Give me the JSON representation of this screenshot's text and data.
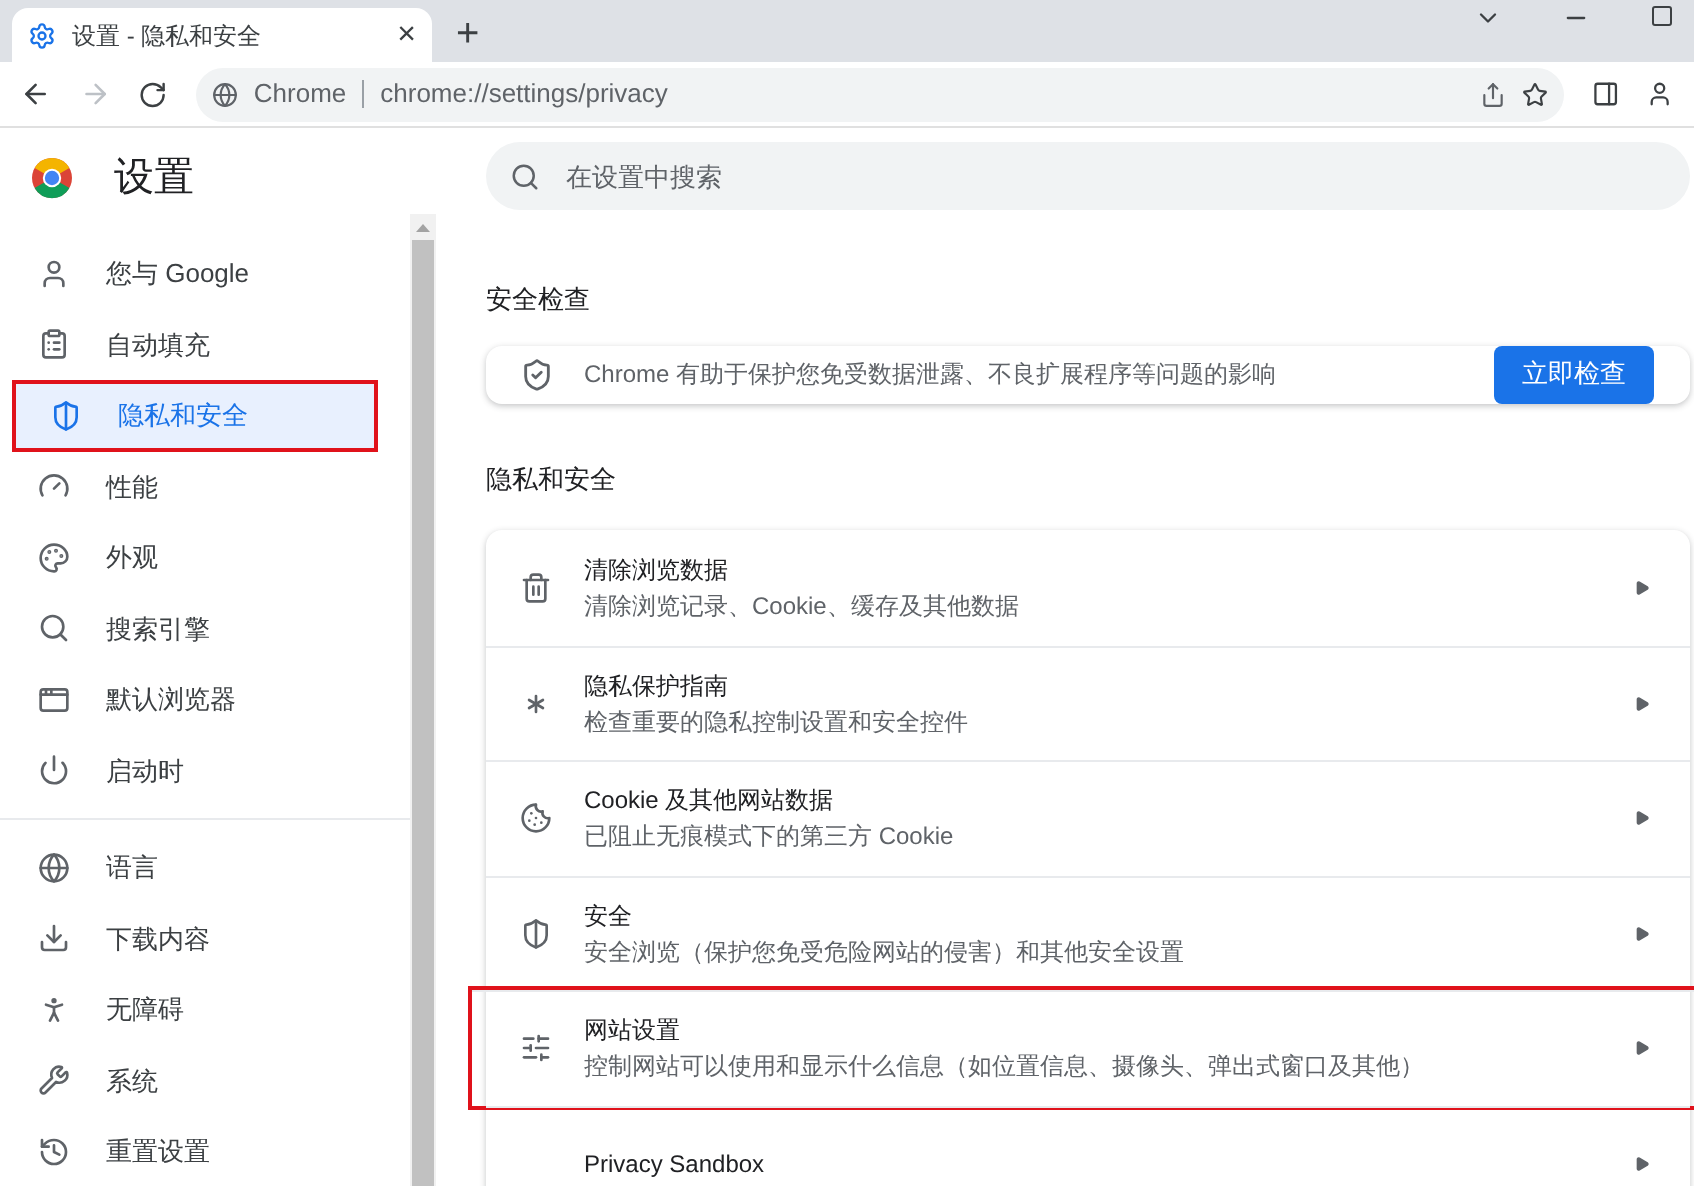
{
  "browser": {
    "tab": {
      "title": "设置 - 隐私和安全",
      "close": "×"
    },
    "new_tab": "+",
    "address": {
      "site": "Chrome",
      "url": "chrome://settings/privacy"
    }
  },
  "header": {
    "title": "设置"
  },
  "sidebar": {
    "groups": [
      [
        {
          "label": "您与 Google",
          "selected": false,
          "highlighted": false
        },
        {
          "label": "自动填充",
          "selected": false,
          "highlighted": false
        },
        {
          "label": "隐私和安全",
          "selected": true,
          "highlighted": true
        },
        {
          "label": "性能",
          "selected": false,
          "highlighted": false
        },
        {
          "label": "外观",
          "selected": false,
          "highlighted": false
        },
        {
          "label": "搜索引擎",
          "selected": false,
          "highlighted": false
        },
        {
          "label": "默认浏览器",
          "selected": false,
          "highlighted": false
        },
        {
          "label": "启动时",
          "selected": false,
          "highlighted": false
        }
      ],
      [
        {
          "label": "语言",
          "selected": false,
          "highlighted": false
        },
        {
          "label": "下载内容",
          "selected": false,
          "highlighted": false
        },
        {
          "label": "无障碍",
          "selected": false,
          "highlighted": false
        },
        {
          "label": "系统",
          "selected": false,
          "highlighted": false
        },
        {
          "label": "重置设置",
          "selected": false,
          "highlighted": false
        }
      ]
    ]
  },
  "search": {
    "placeholder": "在设置中搜索"
  },
  "safety_check": {
    "heading": "安全检查",
    "text": "Chrome 有助于保护您免受数据泄露、不良扩展程序等问题的影响",
    "button": "立即检查"
  },
  "privacy": {
    "heading": "隐私和安全",
    "rows": [
      {
        "title": "清除浏览数据",
        "subtitle": "清除浏览记录、Cookie、缓存及其他数据",
        "highlighted": false
      },
      {
        "title": "隐私保护指南",
        "subtitle": "检查重要的隐私控制设置和安全控件",
        "highlighted": false
      },
      {
        "title": "Cookie 及其他网站数据",
        "subtitle": "已阻止无痕模式下的第三方 Cookie",
        "highlighted": false
      },
      {
        "title": "安全",
        "subtitle": "安全浏览（保护您免受危险网站的侵害）和其他安全设置",
        "highlighted": false
      },
      {
        "title": "网站设置",
        "subtitle": "控制网站可以使用和显示什么信息（如位置信息、摄像头、弹出式窗口及其他）",
        "highlighted": true
      },
      {
        "title": "Privacy Sandbox",
        "highlighted": false
      }
    ]
  }
}
